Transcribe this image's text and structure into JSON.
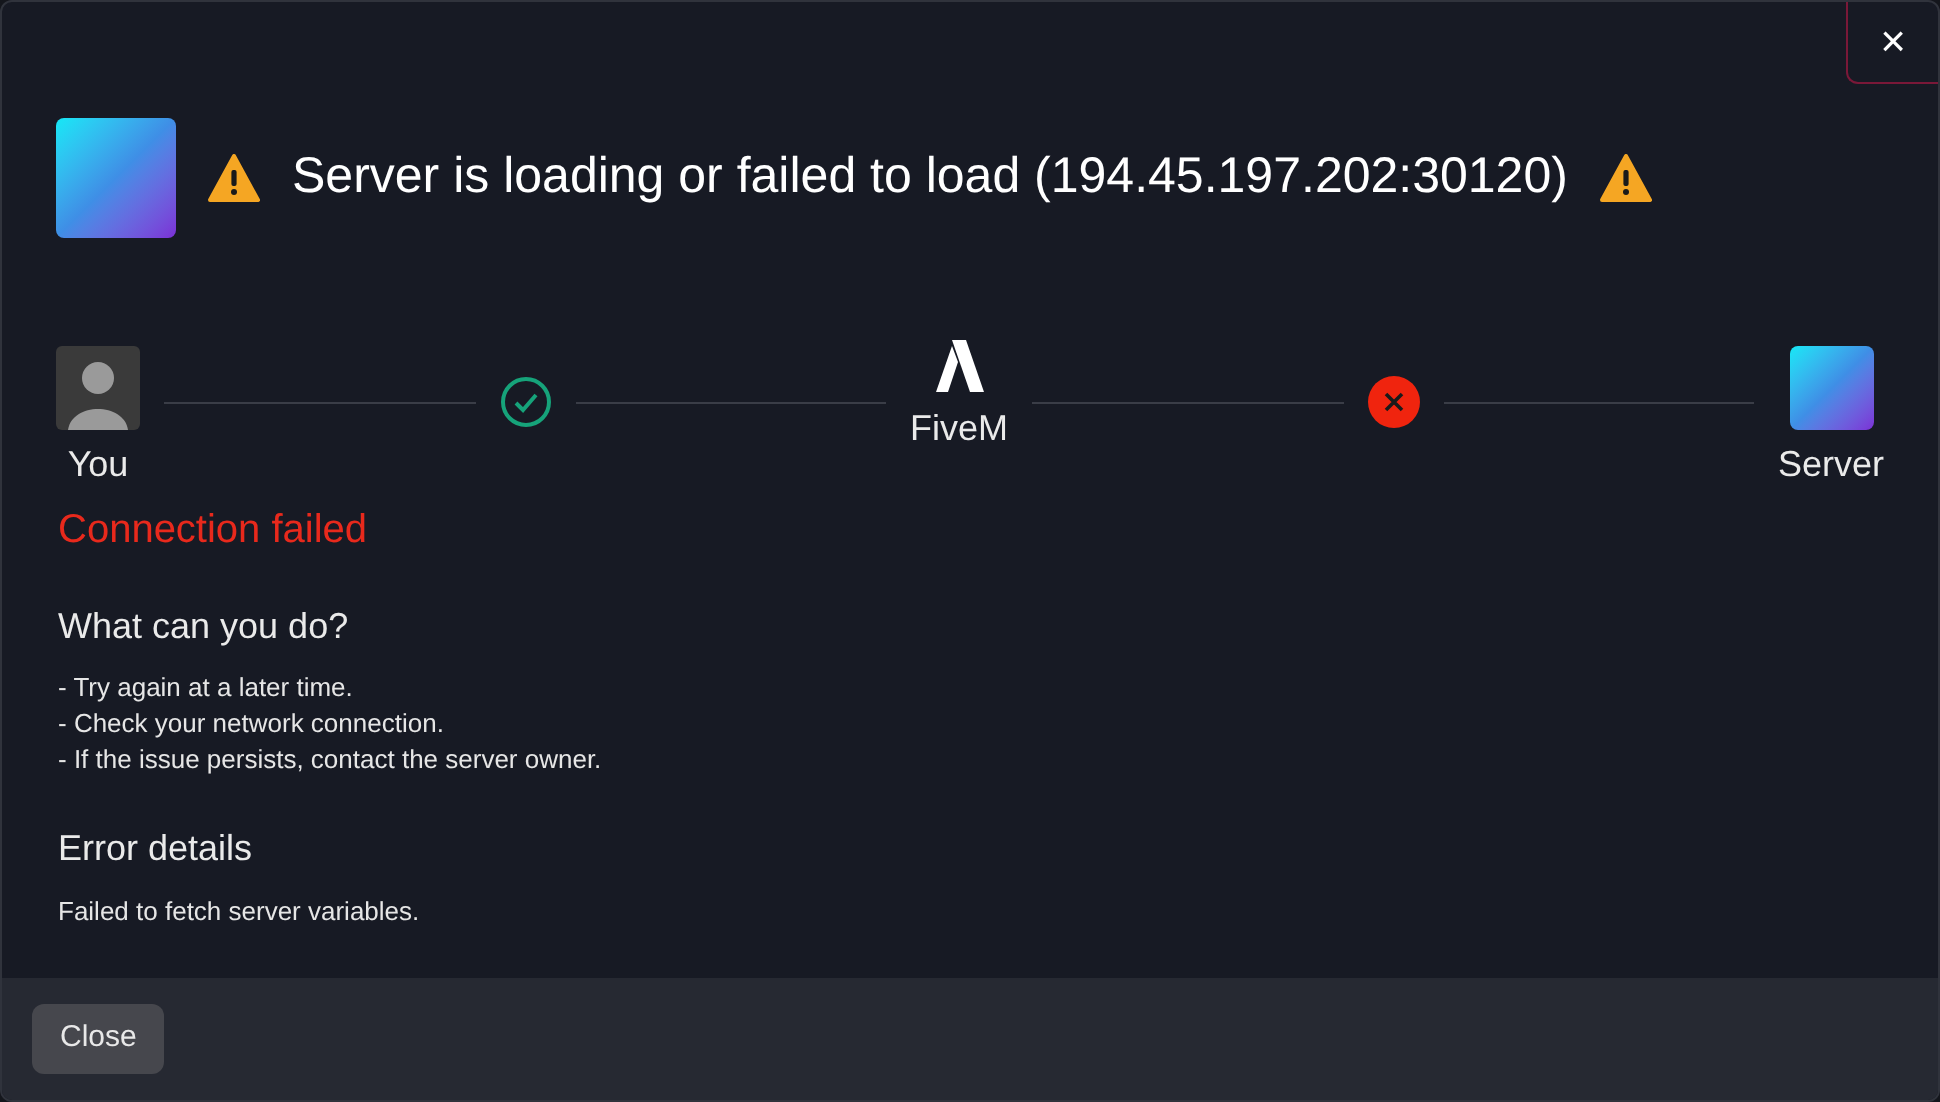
{
  "dialog": {
    "title": "Server is loading or failed to load (194.45.197.202:30120)",
    "close_icon": "×"
  },
  "path": {
    "nodes": [
      {
        "kind": "avatar",
        "label": "You"
      },
      {
        "kind": "app",
        "label": "FiveM"
      },
      {
        "kind": "server",
        "label": "Server"
      }
    ],
    "links": [
      {
        "connected": true
      },
      {
        "connected": false
      }
    ]
  },
  "status": "Connection failed",
  "help": {
    "heading": "What can you do?",
    "lines": [
      "- Try again at a later time.",
      "- Check your network connection.",
      "- If the issue persists, contact the server owner."
    ]
  },
  "error": {
    "heading": "Error details",
    "message": "Failed to fetch server variables."
  },
  "footer": {
    "button": "Close"
  }
}
